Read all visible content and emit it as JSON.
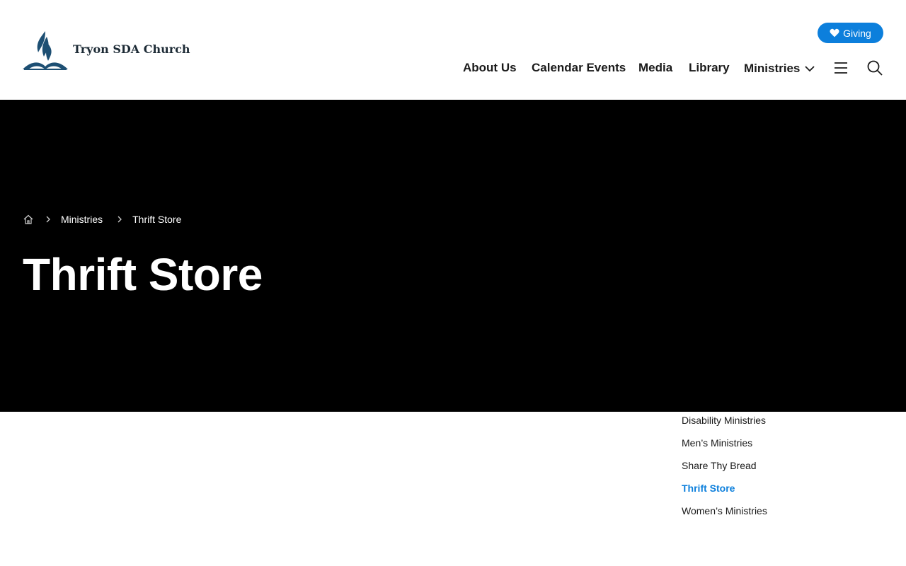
{
  "header": {
    "site_name": "Tryon SDA Church",
    "giving_label": "Giving",
    "nav": [
      {
        "label": "About Us"
      },
      {
        "label": "Calendar Events"
      },
      {
        "label": "Media"
      },
      {
        "label": "Library"
      },
      {
        "label": "Ministries",
        "has_dropdown": true
      }
    ],
    "icons": [
      "heart-icon",
      "chevron-down-icon",
      "menu-icon",
      "search-icon"
    ]
  },
  "breadcrumb": {
    "items": [
      "Ministries",
      "Thrift Store"
    ],
    "icons": [
      "home-icon",
      "chevron-right-icon"
    ]
  },
  "hero": {
    "title": "Thrift Store"
  },
  "subnav": {
    "items": [
      {
        "label": "Disability Ministries",
        "active": false
      },
      {
        "label": "Men’s Ministries",
        "active": false
      },
      {
        "label": "Share Thy Bread",
        "active": false
      },
      {
        "label": "Thrift Store",
        "active": true
      },
      {
        "label": "Women’s Ministries",
        "active": false
      }
    ]
  },
  "colors": {
    "accent": "#0c7fdc",
    "hero_background": "#000000",
    "logo": "#1d4f73",
    "text": "#1a1a1a"
  }
}
